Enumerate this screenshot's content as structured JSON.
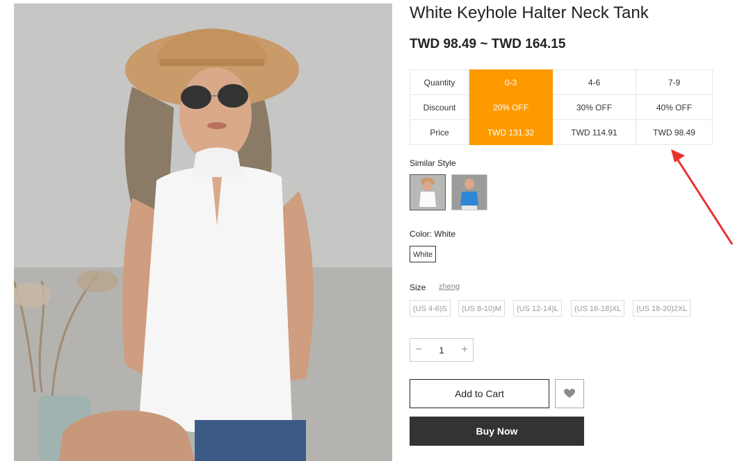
{
  "product": {
    "title": "White Keyhole Halter Neck Tank",
    "price_range": "TWD 98.49 ~ TWD 164.15",
    "image_alt": "model wearing white keyhole halter tank"
  },
  "tiers": {
    "rows": [
      {
        "label": "Quantity",
        "cells": [
          "0-3",
          "4-6",
          "7-9"
        ]
      },
      {
        "label": "Discount",
        "cells": [
          "20% OFF",
          "30% OFF",
          "40% OFF"
        ]
      },
      {
        "label": "Price",
        "cells": [
          "TWD 131.32",
          "TWD 114.91",
          "TWD 98.49"
        ]
      }
    ],
    "active_column": 0,
    "active_color": "#fe9a00"
  },
  "similar": {
    "label": "Similar Style",
    "items": [
      {
        "name": "white-tank",
        "color": "#ffffff"
      },
      {
        "name": "blue-tank",
        "color": "#2f86d6"
      }
    ]
  },
  "color": {
    "label": "Color: White",
    "options": [
      "White"
    ]
  },
  "size": {
    "label": "Size",
    "guide_link": "zheng",
    "options": [
      "(US 4-6)S",
      "(US 8-10)M",
      "(US 12-14)L",
      "(US 16-18)XL",
      "(US 18-20)2XL"
    ]
  },
  "quantity": {
    "minus": "−",
    "value": "1",
    "plus": "+"
  },
  "actions": {
    "add_to_cart": "Add to Cart",
    "buy_now": "Buy Now",
    "wishlist_icon": "heart-icon"
  },
  "annotation": {
    "arrow_color": "#e8322d"
  }
}
